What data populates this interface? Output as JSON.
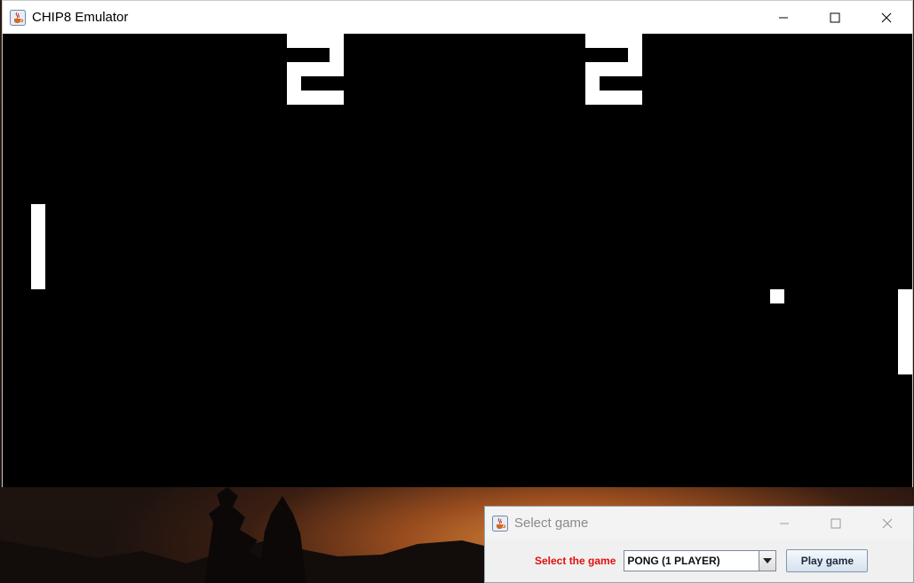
{
  "main_window": {
    "title": "CHIP8 Emulator",
    "icons": {
      "app": "java-cup-icon",
      "minimize": "minimize-icon",
      "maximize": "maximize-icon",
      "close": "close-icon"
    }
  },
  "game": {
    "name": "PONG",
    "score_left": "2",
    "score_right": "2",
    "colors": {
      "background": "#000000",
      "foreground": "#ffffff"
    }
  },
  "dialog": {
    "title": "Select game",
    "label": "Select the game",
    "selected_game": "PONG (1 PLAYER)",
    "play_button": "Play game",
    "label_color": "#e01010"
  }
}
